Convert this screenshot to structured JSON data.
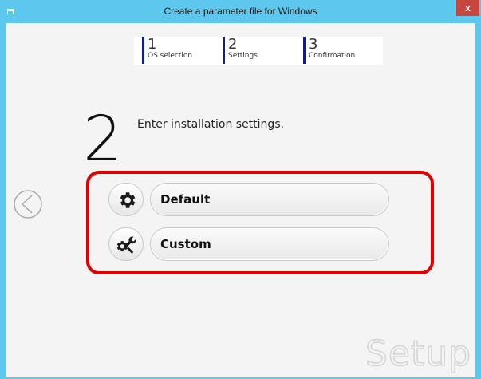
{
  "window": {
    "title": "Create a parameter file for Windows",
    "close_label": "x"
  },
  "steps": [
    {
      "number": "1",
      "label": "OS selection"
    },
    {
      "number": "2",
      "label": "Settings"
    },
    {
      "number": "3",
      "label": "Confirmation"
    }
  ],
  "current_step": "2",
  "prompt": "Enter installation settings.",
  "options": [
    {
      "label": "Default",
      "icon": "gear-icon"
    },
    {
      "label": "Custom",
      "icon": "wrench-gear-icon"
    }
  ],
  "watermark": "Setup",
  "colors": {
    "titlebar": "#5ec7ee",
    "close": "#c7463e",
    "highlight": "#e00000",
    "step_marker": "#0d1e8c"
  }
}
